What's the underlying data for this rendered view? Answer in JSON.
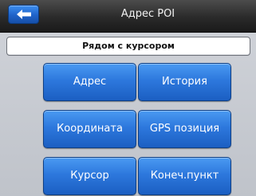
{
  "header": {
    "title": "Адрес POI",
    "back_icon": "arrow-left-icon"
  },
  "subheader": {
    "label": "Рядом с курсором"
  },
  "menu": {
    "buttons": [
      {
        "label": "Адрес"
      },
      {
        "label": "История"
      },
      {
        "label": "Координата"
      },
      {
        "label": "GPS позиция"
      },
      {
        "label": "Курсор"
      },
      {
        "label": "Конеч.пункт"
      }
    ]
  },
  "colors": {
    "button_blue": "#2d78dd",
    "titlebar": "#2a2a2a",
    "background": "#c9ccd3"
  }
}
